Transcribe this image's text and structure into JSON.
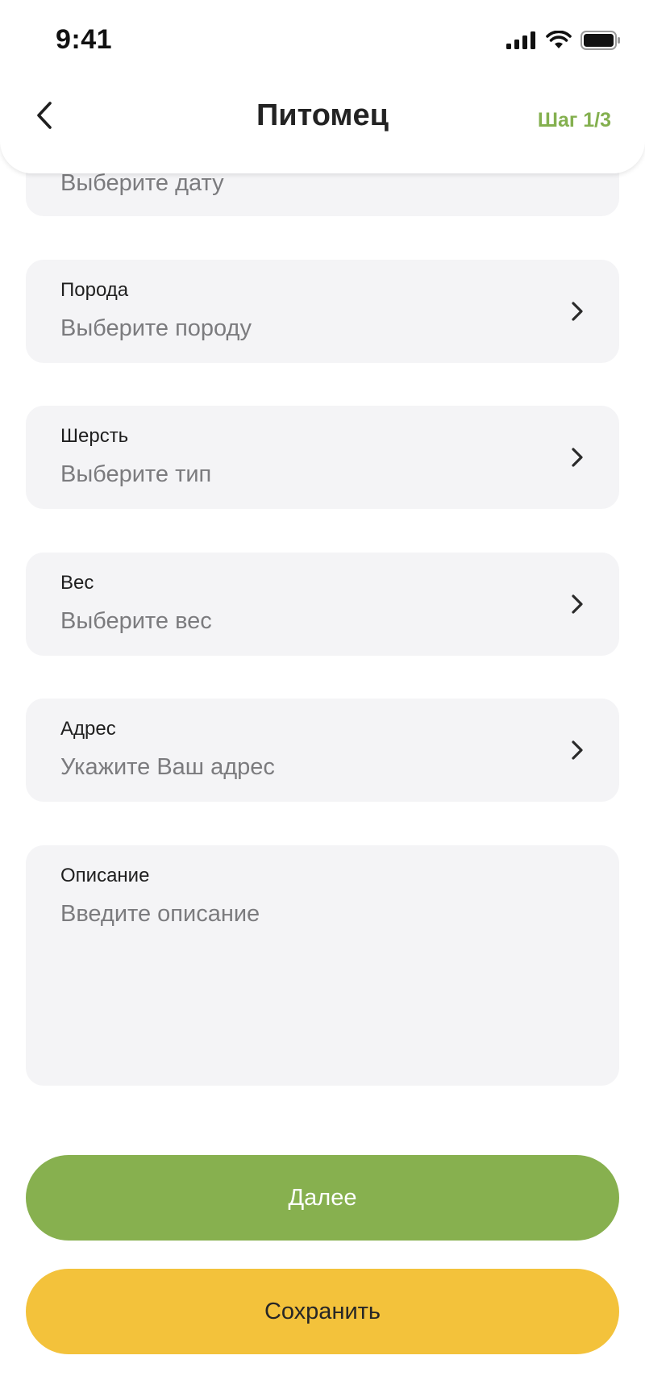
{
  "status_bar": {
    "time": "9:41",
    "icons": [
      "signal-icon",
      "wifi-icon",
      "battery-icon"
    ]
  },
  "nav": {
    "back_icon": "chevron-left-icon",
    "title": "Питомец",
    "step": "Шаг 1/3"
  },
  "fields": {
    "date": {
      "value": "Выберите дату"
    },
    "breed": {
      "label": "Порода",
      "value": "Выберите породу"
    },
    "fur": {
      "label": "Шерсть",
      "value": "Выберите тип"
    },
    "weight": {
      "label": "Вес",
      "value": "Выберите вес"
    },
    "address": {
      "label": "Адрес",
      "value": "Укажите Ваш адрес"
    },
    "description": {
      "label": "Описание",
      "placeholder": "Введите описание"
    }
  },
  "buttons": {
    "next": "Далее",
    "save": "Сохранить"
  },
  "colors": {
    "accent_green": "#87b04f",
    "accent_yellow": "#f3c23b",
    "field_bg": "#f4f4f6",
    "placeholder": "#7b7b7e"
  }
}
